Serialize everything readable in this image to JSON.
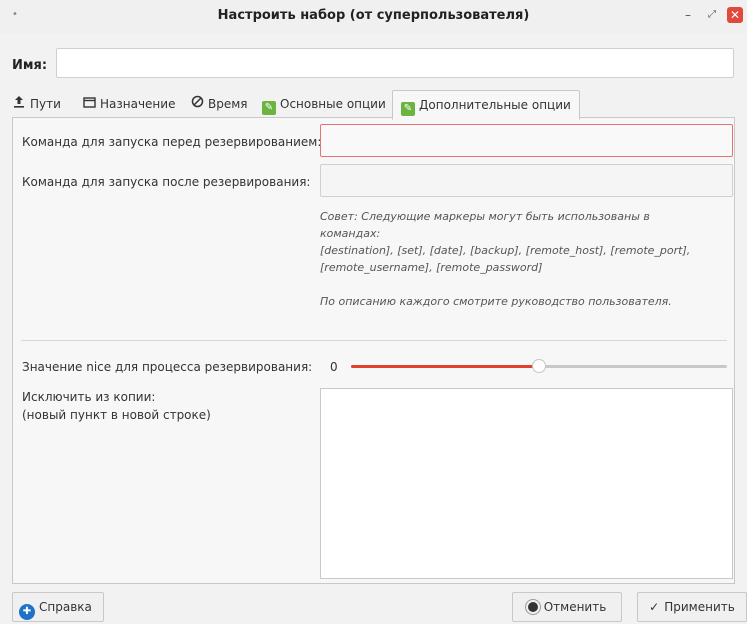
{
  "window": {
    "title": "Настроить набор (от суперпользователя)",
    "controls": {
      "minimize": "–",
      "maximize": "⤢",
      "close": "✕"
    }
  },
  "name": {
    "label": "Имя:",
    "value": "",
    "placeholder": ""
  },
  "tabs": [
    {
      "label": "Пути",
      "icon": "upload-icon"
    },
    {
      "label": "Назначение",
      "icon": "folder-icon"
    },
    {
      "label": "Время",
      "icon": "clock-icon"
    },
    {
      "label": "Основные опции",
      "icon": "edit-icon"
    },
    {
      "label": "Дополнительные опции",
      "icon": "edit-icon",
      "active": true
    }
  ],
  "options": {
    "pre_backup_label": "Команда для запуска перед резервированием:",
    "pre_backup_value": "",
    "post_backup_label": "Команда для запуска после  резервирования:",
    "post_backup_value": "",
    "hint_line1": "Совет: Следующие маркеры могут быть использованы в командах:",
    "hint_line2": "[destination], [set], [date], [backup], [remote_host], [remote_port], [remote_username], [remote_password]",
    "hint_line3": "По описанию каждого смотрите руководство пользователя.",
    "nice_label": "Значение nice для процесса резервирования:",
    "nice_value": "0",
    "nice_fill": 0.5,
    "exclude_label_line1": "Исключить из копии:",
    "exclude_label_line2": "(новый пункт в новой строке)"
  },
  "buttons": {
    "help": "Справка",
    "cancel": "Отменить",
    "apply": "Применить"
  },
  "colors": {
    "accent": "#e0412e",
    "error_border": "#e57373",
    "tab_icon": "#6cb33f",
    "help_icon": "#1e73c9"
  }
}
